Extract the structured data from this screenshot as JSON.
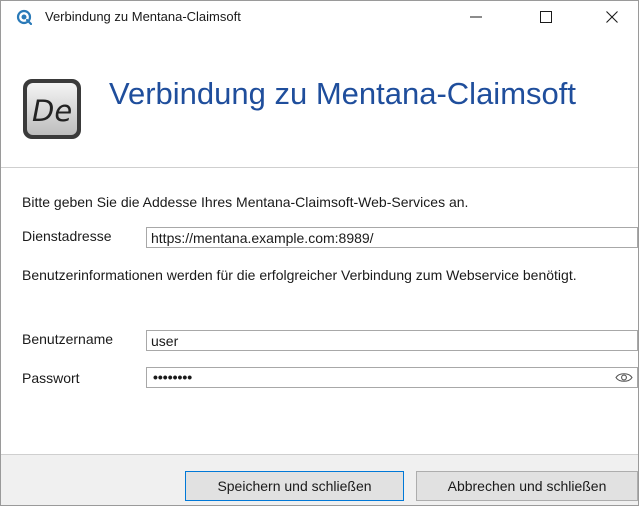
{
  "window": {
    "title": "Verbindung zu Mentana-Claimsoft",
    "minimize_glyph": "—",
    "close_glyph": "✕"
  },
  "header": {
    "heading": "Verbindung zu Mentana-Claimsoft",
    "logo_text": "De",
    "logo_icon": "de-logo-icon"
  },
  "form": {
    "intro": "Bitte geben Sie die Addesse Ihres Mentana-Claimsoft-Web-Services an.",
    "service_address_label": "Dienstadresse",
    "service_address_value": "https://mentana.example.com:8989/",
    "user_info_note": "Benutzerinformationen werden für die erfolgreicher Verbindung zum Webservice benötigt.",
    "username_label": "Benutzername",
    "username_value": "user",
    "password_label": "Passwort",
    "password_masked": "••••••••",
    "password_reveal_icon": "eye-icon"
  },
  "footer": {
    "save_label": "Speichern und schließen",
    "cancel_label": "Abbrechen und schließen"
  },
  "colors": {
    "heading": "#1f4e9c",
    "focus_border": "#0078d7",
    "footer_bg": "#f0f0f0"
  }
}
